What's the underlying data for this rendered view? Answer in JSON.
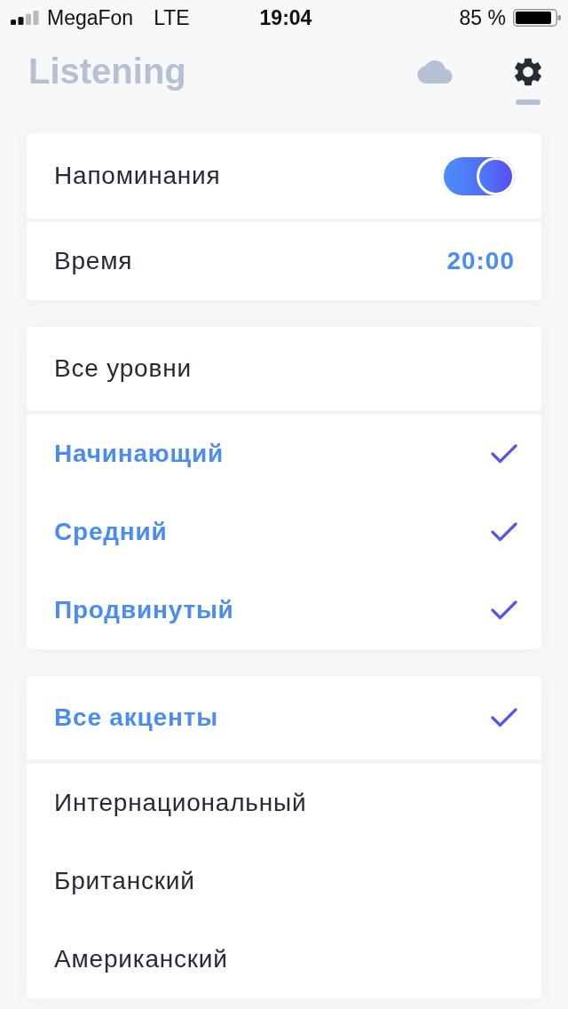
{
  "status_bar": {
    "carrier": "MegaFon",
    "network": "LTE",
    "time": "19:04",
    "battery": "85 %"
  },
  "header": {
    "title": "Listening",
    "tabs": [
      {
        "kind": "cloud",
        "selected": false
      },
      {
        "kind": "settings",
        "selected": true
      }
    ]
  },
  "reminders": {
    "label": "Напоминания",
    "on": true
  },
  "time": {
    "label": "Время",
    "value": "20:00"
  },
  "levels": {
    "all": {
      "label": "Все уровни",
      "selected": false
    },
    "items": [
      {
        "label": "Начинающий",
        "selected": true
      },
      {
        "label": "Средний",
        "selected": true
      },
      {
        "label": "Продвинутый",
        "selected": true
      }
    ]
  },
  "accents": {
    "all": {
      "label": "Все акценты",
      "selected": true
    },
    "items": [
      {
        "label": "Интернациональный",
        "selected": false
      },
      {
        "label": "Британский",
        "selected": false
      },
      {
        "label": "Американский",
        "selected": false
      }
    ]
  }
}
